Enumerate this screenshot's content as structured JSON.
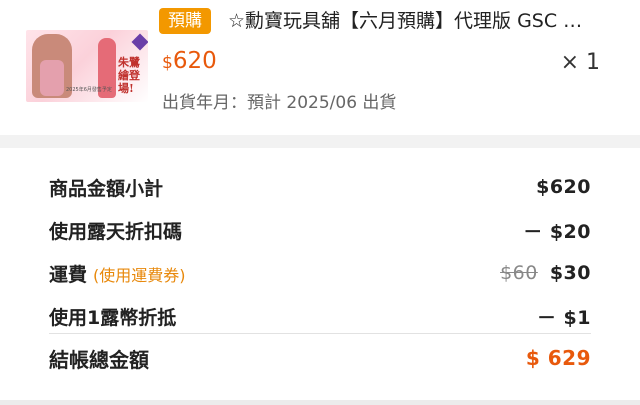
{
  "product": {
    "badge": "預購",
    "title": "☆勳寶玩具舖【六月預購】代理版 GSC POP UP PARADE 龍族拼圖 菲亞拉",
    "image_text": "朱鷺繪登場!",
    "image_caption": "2025年6月發售予定",
    "price_currency": "$",
    "price_amount": "620",
    "quantity": "× 1",
    "ship_date": "出貨年月：預計 2025/06 出貨"
  },
  "summary": {
    "rows": [
      {
        "label": "商品金額小計",
        "value": "$620"
      },
      {
        "label": "使用露天折扣碼",
        "value": "－ $20"
      },
      {
        "label": "運費",
        "note": "(使用運費券)",
        "original": "$60",
        "value": "$30"
      },
      {
        "label": "使用1露幣折抵",
        "value": "－ $1"
      }
    ],
    "total_label": "結帳總金額",
    "total_value": "$ 629"
  },
  "colors": {
    "accent": "#e8590c",
    "badge": "#f39800",
    "note": "#e8890c"
  }
}
